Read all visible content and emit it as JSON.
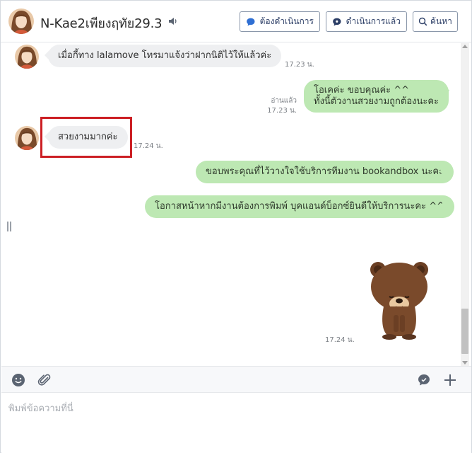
{
  "header": {
    "contact_name": "N-Kae2เพียงฤทัย29.3",
    "buttons": {
      "todo_label": "ต้องดำเนินการ",
      "done_label": "ดำเนินการแล้ว",
      "search_label": "ค้นหา"
    }
  },
  "messages": [
    {
      "direction": "in",
      "text": "เมื่อกี้ทาง lalamove โทรมาแจ้งว่าฝากนิติไว้ให้แล้วค่ะ",
      "time": "17.23 น."
    },
    {
      "direction": "out",
      "lines": [
        "โอเคค่ะ ขอบคุณค่ะ ^^",
        "ทั้งนี้ตัวงานสวยงามถูกต้องนะคะ"
      ],
      "read_label": "อ่านแล้ว",
      "time": "17.23 น."
    },
    {
      "direction": "in",
      "text": "สวยงามมากค่ะ",
      "time": "17.24 น.",
      "highlighted": true
    },
    {
      "direction": "out",
      "text": "ขอบพระคุณที่ไว้วางใจใช้บริการทีมงาน bookandbox นะคะ"
    },
    {
      "direction": "out",
      "text": "โอกาสหน้าหากมีงานต้องการพิมพ์ บุคแอนด์บ็อกซ์ยินดีให้บริการนะคะ ^^"
    },
    {
      "direction": "out",
      "type": "sticker",
      "sticker": "brown-bear-bowing",
      "time": "17.24 น."
    }
  ],
  "toolbar": {
    "icons": [
      "emoji-icon",
      "attachment-icon",
      "quick-reply-icon",
      "plus-icon"
    ]
  },
  "composer": {
    "placeholder": "พิมพ์ข้อความที่นี่"
  },
  "colors": {
    "outgoing_bubble": "#bde8b3",
    "incoming_bubble": "#eeeff1",
    "highlight_border": "#cc1f24",
    "button_text": "#2c3e66"
  }
}
